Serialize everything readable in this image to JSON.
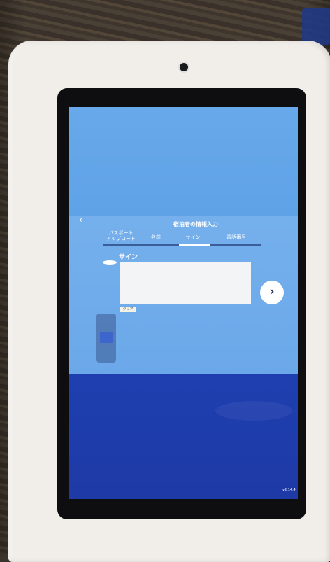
{
  "kiosk": {
    "header": {
      "title": "宿泊者の情報入力",
      "back_icon": "‹"
    },
    "tabs": [
      {
        "label": "パスポート\nアップロード",
        "active": false
      },
      {
        "label": "名前",
        "active": false
      },
      {
        "label": "サイン",
        "active": true
      },
      {
        "label": "電話番号",
        "active": false
      }
    ],
    "signature": {
      "label": "サイン",
      "clear_label": "クリア"
    },
    "next_button": {
      "icon": "›"
    },
    "version": "v2.14.4"
  },
  "colors": {
    "screen_light_blue": "#6ba8ea",
    "screen_dark_blue": "#1e3aa6",
    "frame": "#f1eeea",
    "bezel": "#0e0e10"
  }
}
